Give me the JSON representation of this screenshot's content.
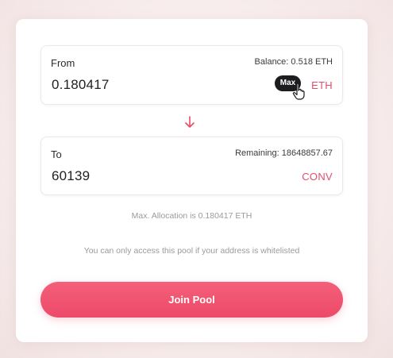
{
  "from": {
    "label": "From",
    "balance": "Balance: 0.518 ETH",
    "value": "0.180417",
    "max_label": "Max",
    "token": "ETH"
  },
  "to": {
    "label": "To",
    "remaining": "Remaining: 18648857.67",
    "value": "60139",
    "token": "CONV"
  },
  "allocation_text": "Max. Allocation is 0.180417 ETH",
  "whitelist_text": "You can only access this pool if your address is whitelisted",
  "join_button_label": "Join Pool",
  "colors": {
    "accent": "#ec4a68",
    "token_text": "#e24d6b",
    "max_button": "#1d1d1f"
  },
  "icons": {
    "swap_arrow": "arrow-down-icon",
    "cursor": "pointer-hand-icon"
  }
}
